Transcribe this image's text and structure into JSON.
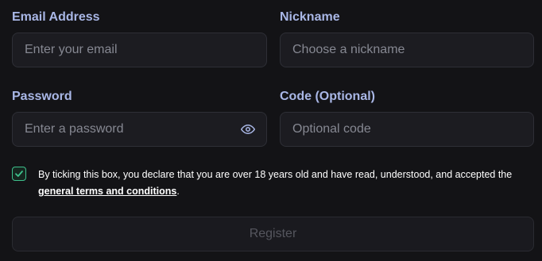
{
  "form": {
    "email": {
      "label": "Email Address",
      "placeholder": "Enter your email",
      "value": ""
    },
    "nickname": {
      "label": "Nickname",
      "placeholder": "Choose a nickname",
      "value": ""
    },
    "password": {
      "label": "Password",
      "placeholder": "Enter a password",
      "value": "",
      "toggle_icon": "eye-icon"
    },
    "code": {
      "label": "Code (Optional)",
      "placeholder": "Optional code",
      "value": ""
    },
    "terms": {
      "checked": true,
      "text": "By ticking this box, you declare that you are over 18 years old and have read, understood, and accepted the ",
      "link_text": "general terms and conditions",
      "suffix": "."
    },
    "register_label": "Register",
    "register_disabled": true
  },
  "colors": {
    "background": "#131316",
    "label": "#a9b7e6",
    "field_bg": "#1c1c21",
    "field_border": "#2e2f36",
    "placeholder": "#868892",
    "checkbox_accent": "#3ec08c",
    "button_text_disabled": "#55565e"
  }
}
